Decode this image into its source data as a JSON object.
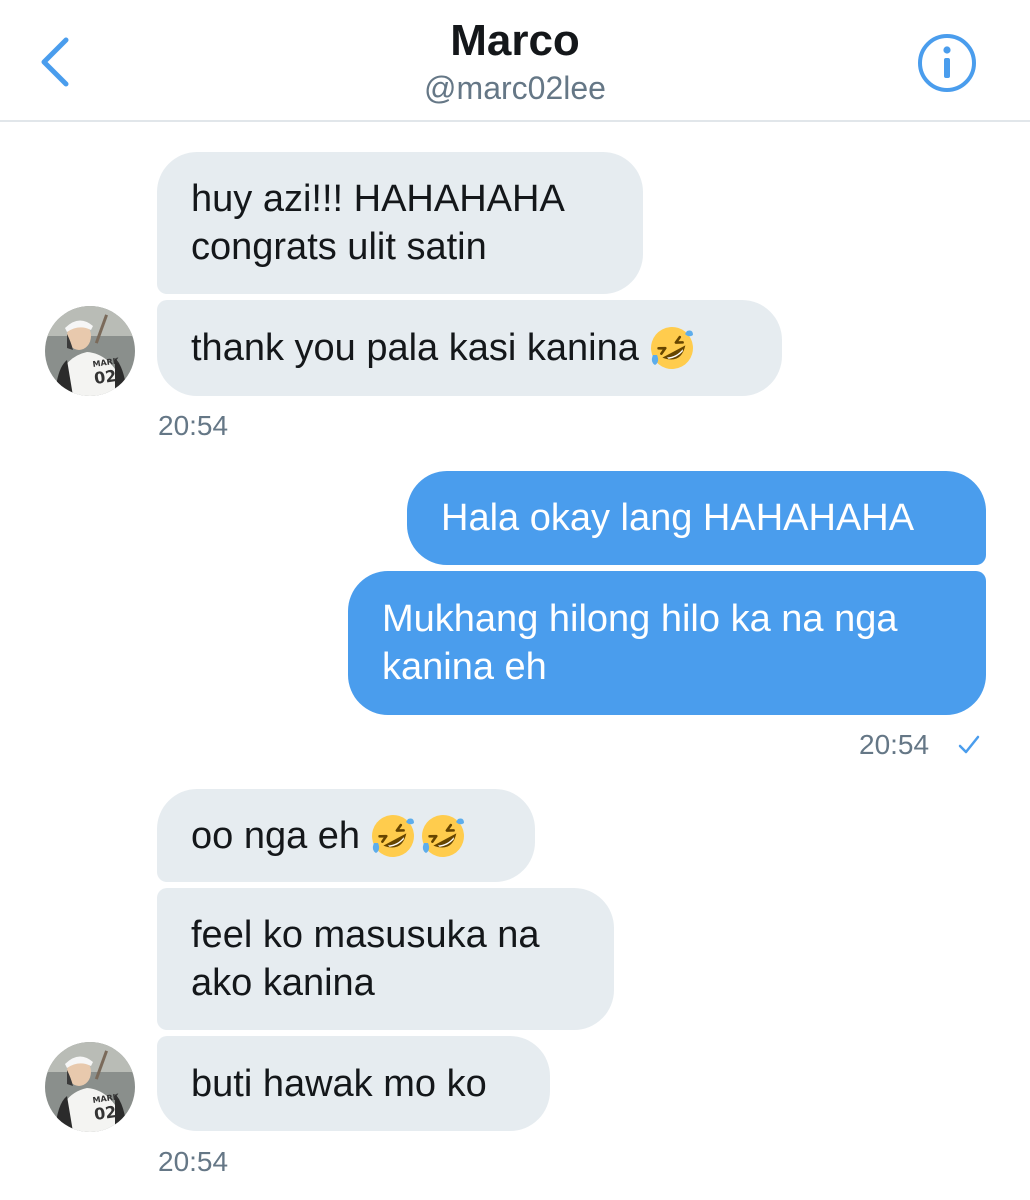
{
  "header": {
    "name": "Marco",
    "handle": "@marc02lee",
    "back_icon": "chevron-left-icon",
    "info_icon": "info-icon"
  },
  "colors": {
    "accent": "#4a9ded",
    "incoming_bubble": "#e6ecf0",
    "outgoing_bubble": "#4a9ded",
    "timestamp": "#657786"
  },
  "messages": {
    "group1": {
      "m1_line1": "huy azi!!! HAHAHAHA",
      "m1_line2": "congrats ulit satin",
      "m2": "thank you pala kasi kanina",
      "time": "20:54",
      "avatar_text": "MARK 02"
    },
    "group2": {
      "m1": "Hala okay lang HAHAHAHA",
      "m2_line1": "Mukhang hilong hilo ka na nga",
      "m2_line2": "kanina eh",
      "time": "20:54",
      "status_icon": "checkmark-icon"
    },
    "group3": {
      "m1": "oo nga eh",
      "m2_line1": "feel ko masusuka na",
      "m2_line2": "ako kanina",
      "m3": "buti hawak mo ko",
      "time": "20:54",
      "avatar_text": "MARK 02"
    },
    "emoji_icon": "rolling-on-floor-laughing-emoji"
  }
}
